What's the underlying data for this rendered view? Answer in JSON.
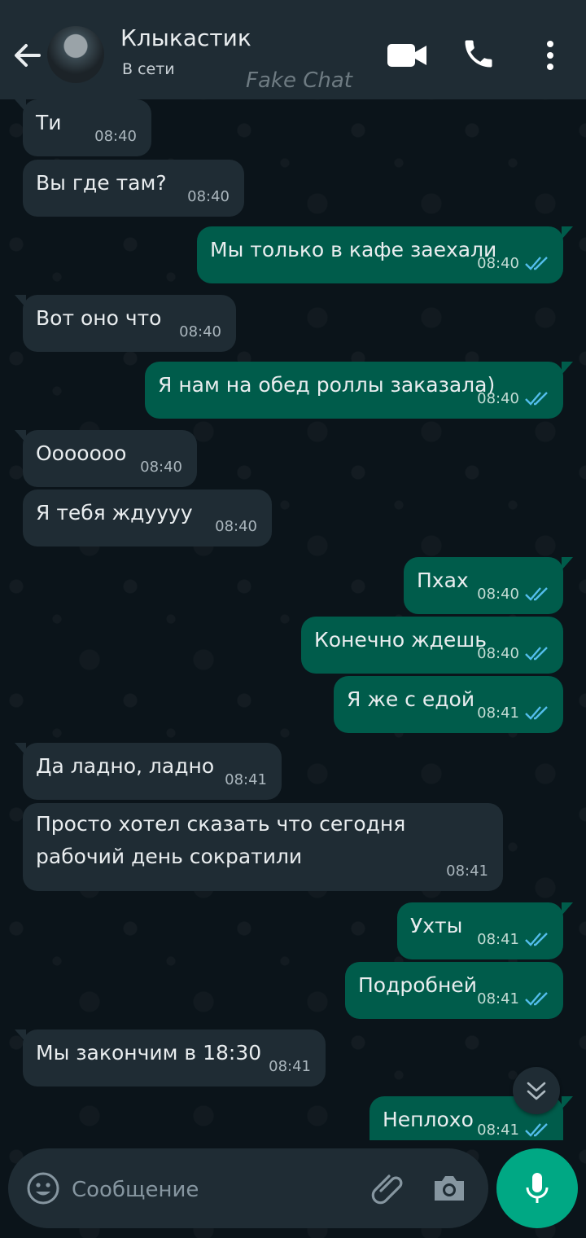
{
  "header": {
    "contact_name": "Клыкастик",
    "status": "В сети",
    "watermark": "Fake Chat",
    "icons": [
      "back-arrow-icon",
      "video-call-icon",
      "phone-icon",
      "more-vert-icon"
    ]
  },
  "messages": [
    {
      "dir": "in",
      "text": "Ти",
      "time": "08:40"
    },
    {
      "dir": "in",
      "text": "Вы где там?",
      "time": "08:40"
    },
    {
      "dir": "out",
      "text": "Мы только в кафе заехали",
      "time": "08:40"
    },
    {
      "dir": "in",
      "text": "Вот оно что",
      "time": "08:40"
    },
    {
      "dir": "out",
      "text": "Я нам на обед роллы заказала)",
      "time": "08:40"
    },
    {
      "dir": "in",
      "text": "Ооооооо",
      "time": "08:40"
    },
    {
      "dir": "in",
      "text": "Я тебя ждуууу",
      "time": "08:40"
    },
    {
      "dir": "out",
      "text": "Пхах",
      "time": "08:40"
    },
    {
      "dir": "out",
      "text": "Конечно ждешь",
      "time": "08:40"
    },
    {
      "dir": "out",
      "text": "Я же с едой",
      "time": "08:41"
    },
    {
      "dir": "in",
      "text": "Да ладно, ладно",
      "time": "08:41"
    },
    {
      "dir": "in",
      "text": "Просто хотел сказать что сегодня рабочий день сократили",
      "time": "08:41"
    },
    {
      "dir": "out",
      "text": "Ухты",
      "time": "08:41"
    },
    {
      "dir": "out",
      "text": "Подробней",
      "time": "08:41"
    },
    {
      "dir": "in",
      "text": "Мы закончим в 18:30",
      "time": "08:41"
    },
    {
      "dir": "out",
      "text": "Неплохо",
      "time": "08:41"
    }
  ],
  "composer": {
    "placeholder": "Сообщение",
    "icons": [
      "emoji-icon",
      "attach-icon",
      "camera-icon",
      "mic-icon"
    ]
  },
  "colors": {
    "header_bg": "#1f2c34",
    "incoming_bubble": "#1f2c34",
    "outgoing_bubble": "#005c4b",
    "read_ticks": "#53bdeb",
    "mic_button": "#00a884"
  }
}
